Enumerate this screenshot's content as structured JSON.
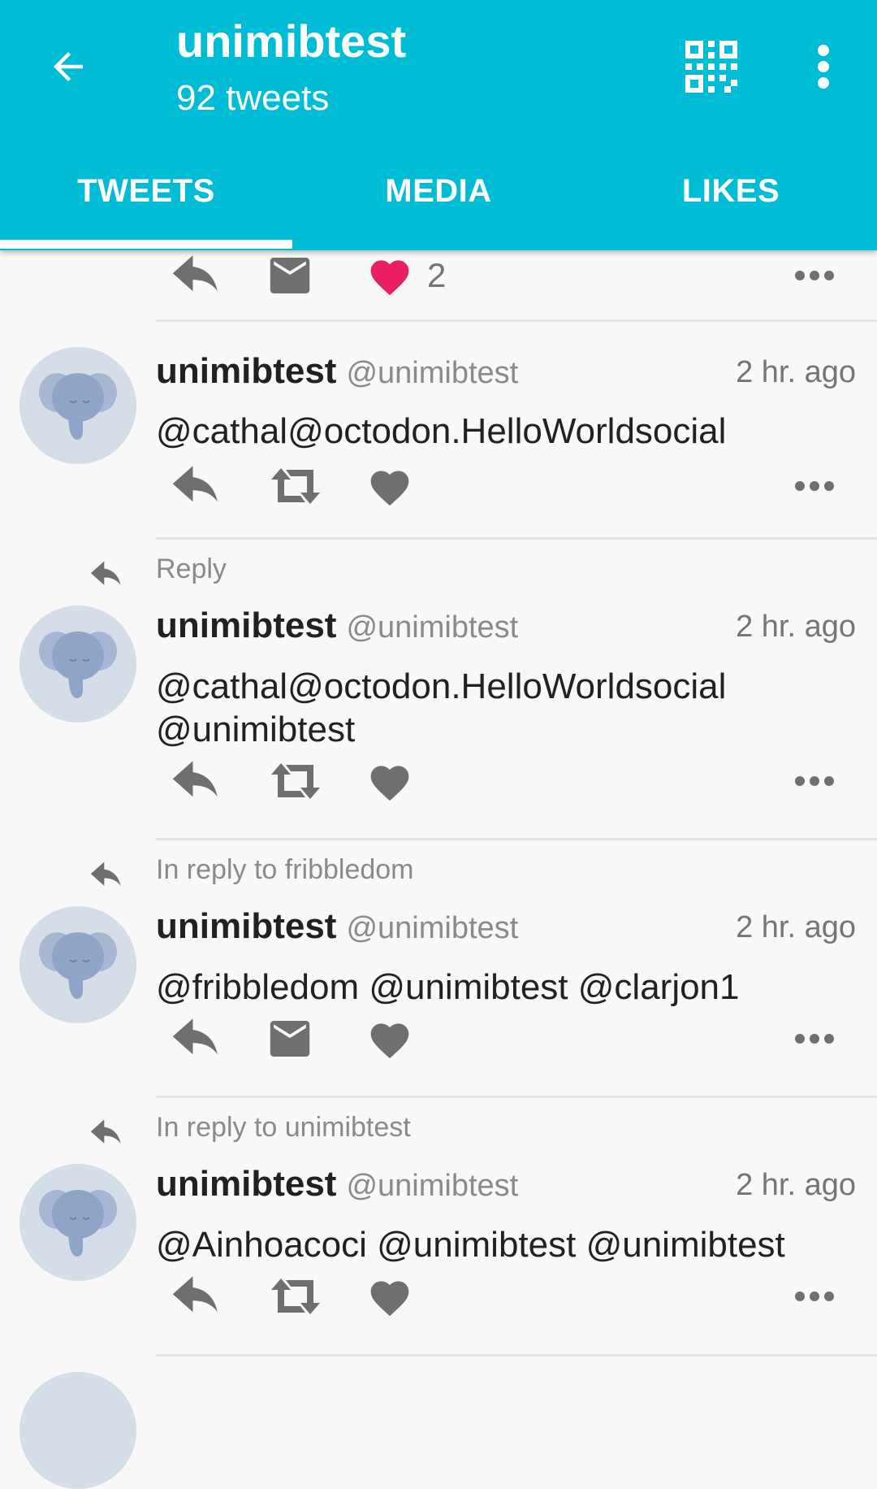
{
  "appbar": {
    "title": "unimibtest",
    "subtitle": "92 tweets",
    "tabs": [
      "TWEETS",
      "MEDIA",
      "LIKES"
    ],
    "active_tab": "TWEETS"
  },
  "top_actions": {
    "favourites_count": "2",
    "second_action_icon": "mail-icon",
    "favourited": true
  },
  "tweets": [
    {
      "context": "",
      "display_name": "unimibtest",
      "handle": "@unimibtest",
      "time": "2 hr. ago",
      "content": "@cathal@octodon.HelloWorldsocial",
      "second_action_icon": "boost-icon"
    },
    {
      "context": "Reply",
      "display_name": "unimibtest",
      "handle": "@unimibtest",
      "time": "2 hr. ago",
      "content": "@cathal@octodon.HelloWorldsocial @unimibtest",
      "second_action_icon": "boost-icon"
    },
    {
      "context": "In reply to fribbledom",
      "display_name": "unimibtest",
      "handle": "@unimibtest",
      "time": "2 hr. ago",
      "content": "@fribbledom @unimibtest @clarjon1",
      "second_action_icon": "mail-icon"
    },
    {
      "context": "In reply to unimibtest",
      "display_name": "unimibtest",
      "handle": "@unimibtest",
      "time": "2 hr. ago",
      "content": "@Ainhoacoci @unimibtest @unimibtest",
      "second_action_icon": "boost-icon"
    }
  ],
  "colors": {
    "primary": "#00bcd4",
    "favourite_active": "#e91e63",
    "icon_gray": "#6f6f6f"
  }
}
